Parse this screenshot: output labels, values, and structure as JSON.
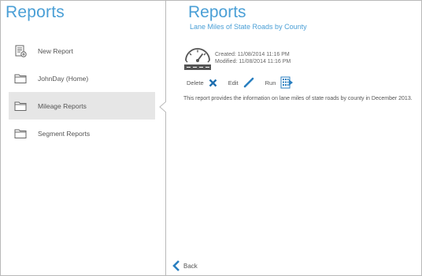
{
  "left_pane": {
    "title": "Reports",
    "items": [
      {
        "label": "New Report",
        "icon": "new-report-icon",
        "active": false
      },
      {
        "label": "JohnDay (Home)",
        "icon": "folder-icon",
        "active": false
      },
      {
        "label": "Mileage Reports",
        "icon": "folder-icon",
        "active": true
      },
      {
        "label": "Segment Reports",
        "icon": "folder-icon",
        "active": false
      }
    ]
  },
  "report": {
    "title": "Reports",
    "subtitle": "Lane Miles of State Roads by County",
    "created": "Created: 11/08/2014 11:16 PM",
    "modified": "Modified: 11/08/2014 11:16 PM",
    "actions": {
      "delete_label": "Delete",
      "edit_label": "Edit",
      "run_label": "Run"
    },
    "description": "This report provides the information on lane miles of state roads by county in December 2013."
  },
  "footer": {
    "back_label": "Back"
  },
  "colors": {
    "accent": "#4a9fd6",
    "active_bg": "#e6e6e6",
    "delete_icon": "#1e6fb0",
    "border": "#b9b9b9"
  }
}
